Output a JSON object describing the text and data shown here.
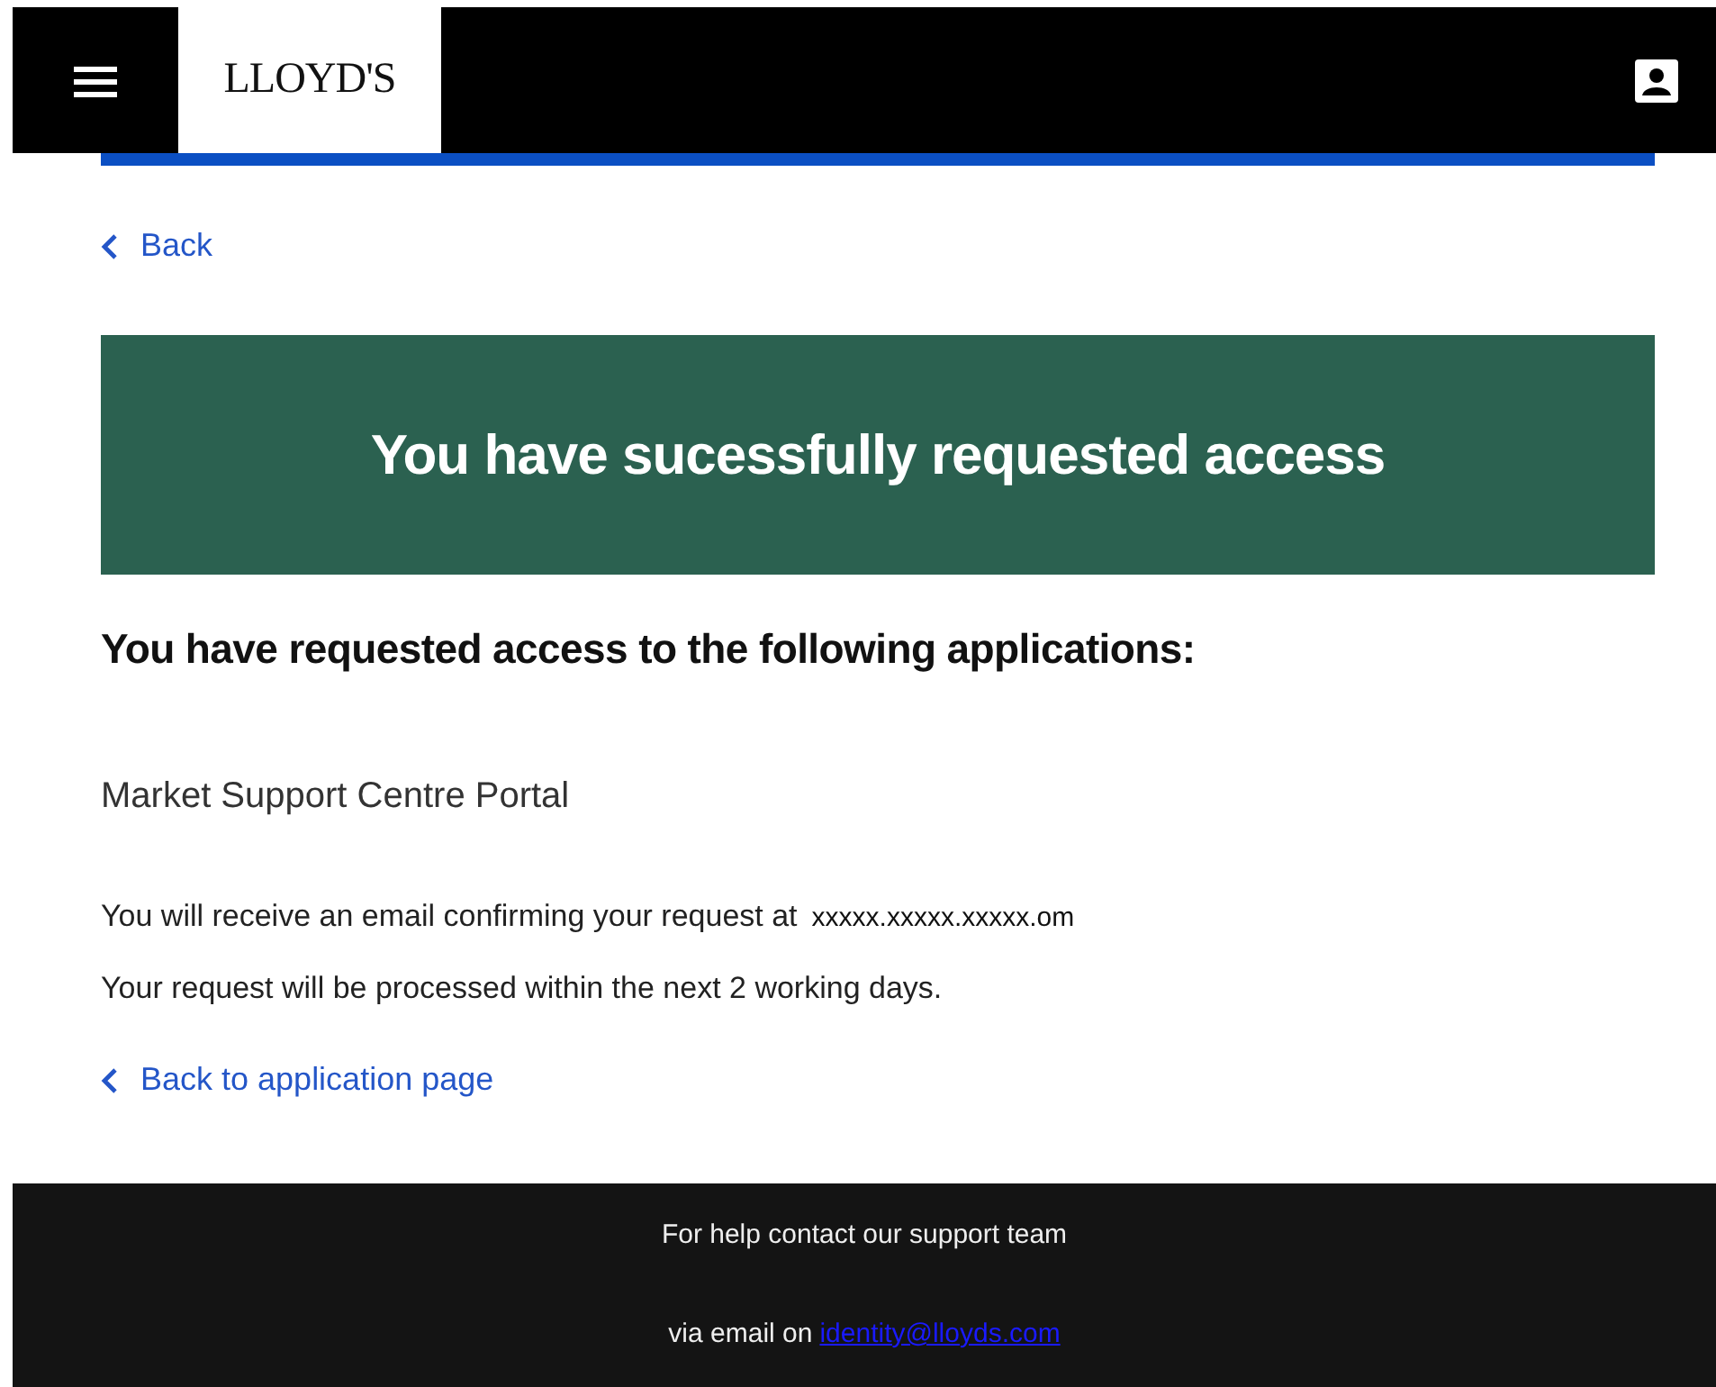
{
  "header": {
    "logo": "LLOYD'S"
  },
  "back_link": "Back",
  "banner": {
    "title": "You have sucessfully requested access"
  },
  "heading": "You have requested access to the following applications:",
  "applications": [
    "Market Support Centre Portal"
  ],
  "confirmation": {
    "text": "You will receive an email confirming your request at",
    "email": "xxxxx.xxxxx.xxxxx.om"
  },
  "processing_note": "Your request will be processed within the next 2 working days.",
  "return_link": "Back to application page",
  "footer": {
    "help_text": "For help contact our support team",
    "email_prefix": "via email on",
    "email_link": "identity@lloyds.com"
  }
}
